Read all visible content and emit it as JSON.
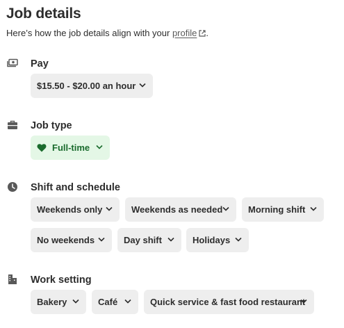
{
  "page": {
    "title": "Job details",
    "subtitle_prefix": "Here’s how the job details align with your ",
    "subtitle_link": "profile",
    "subtitle_suffix": "."
  },
  "sections": {
    "pay": {
      "title": "Pay",
      "icon": "money-icon",
      "chips": [
        "$15.50 - $20.00 an hour"
      ]
    },
    "job_type": {
      "title": "Job type",
      "icon": "briefcase-icon",
      "chips": [
        "Full-time"
      ],
      "matched_color": "#1a6b2d"
    },
    "schedule": {
      "title": "Shift and schedule",
      "icon": "clock-icon",
      "chips": [
        "Weekends only",
        "Weekends as needed",
        "Morning shift",
        "No weekends",
        "Day shift",
        "Holidays"
      ]
    },
    "work_setting": {
      "title": "Work setting",
      "icon": "building-icon",
      "chips": [
        "Bakery",
        "Café",
        "Quick service & fast food restaurant"
      ]
    }
  },
  "colors": {
    "chip_bg": "#eeeeee",
    "matched_bg": "#e4f7e6",
    "text": "#2d2d2d"
  }
}
